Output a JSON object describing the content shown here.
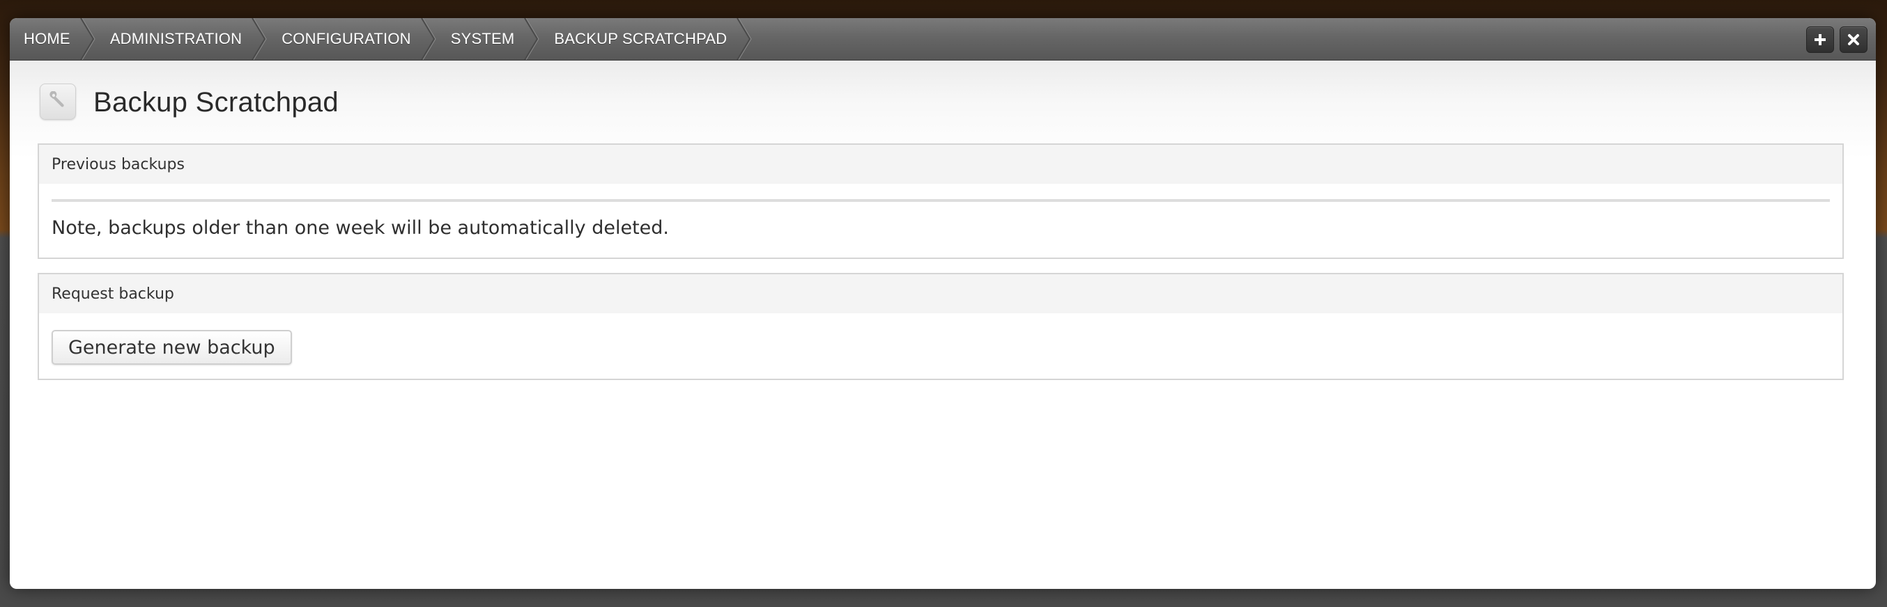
{
  "breadcrumb": {
    "items": [
      {
        "label": "HOME"
      },
      {
        "label": "ADMINISTRATION"
      },
      {
        "label": "CONFIGURATION"
      },
      {
        "label": "SYSTEM"
      },
      {
        "label": "BACKUP SCRATCHPAD"
      }
    ]
  },
  "toolbar": {
    "expand_icon": "plus-icon",
    "close_icon": "close-icon"
  },
  "page": {
    "title": "Backup Scratchpad",
    "title_icon": "wrench-icon"
  },
  "panels": {
    "previous_backups": {
      "heading": "Previous backups",
      "note": "Note, backups older than one week will be automatically deleted."
    },
    "request_backup": {
      "heading": "Request backup",
      "button_label": "Generate new backup"
    }
  },
  "colors": {
    "toolbar": "#666666",
    "overlay_background": "#ffffff",
    "panel_border": "#d5d5d5",
    "panel_header": "#f4f4f4"
  }
}
